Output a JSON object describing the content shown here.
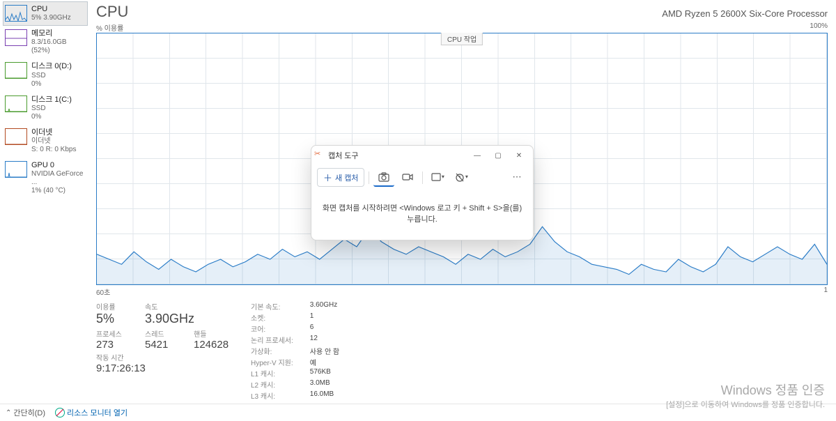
{
  "sidebar": [
    {
      "title": "CPU",
      "sub1": "5% 3.90GHz",
      "color": "#2a7cc7"
    },
    {
      "title": "메모리",
      "sub1": "8.3/16.0GB (52%)",
      "color": "#7a3fb1"
    },
    {
      "title": "디스크 0(D:)",
      "sub1": "SSD",
      "sub2": "0%",
      "color": "#4a9b2e"
    },
    {
      "title": "디스크 1(C:)",
      "sub1": "SSD",
      "sub2": "0%",
      "color": "#4a9b2e"
    },
    {
      "title": "이더넷",
      "sub1": "이더넷",
      "sub2": "S: 0 R: 0 Kbps",
      "color": "#b24a20"
    },
    {
      "title": "GPU 0",
      "sub1": "NVIDIA GeForce ...",
      "sub2": "1% (40 °C)",
      "color": "#2a7cc7"
    }
  ],
  "header": {
    "title": "CPU",
    "sub": "AMD Ryzen 5 2600X Six-Core Processor"
  },
  "axis": {
    "ylabel": "% 이용률",
    "ymax": "100%",
    "xmin": "60초",
    "xmax": "1"
  },
  "chart_tab": "CPU 작업",
  "stats": {
    "util_label": "이용률",
    "util": "5%",
    "speed_label": "속도",
    "speed": "3.90GHz",
    "proc_label": "프로세스",
    "proc": "273",
    "thread_label": "스레드",
    "thread": "5421",
    "handle_label": "핸들",
    "handle": "124628",
    "uptime_label": "작동 시간",
    "uptime": "9:17:26:13"
  },
  "right": [
    [
      "기본 속도:",
      "3.60GHz"
    ],
    [
      "소켓:",
      "1"
    ],
    [
      "코어:",
      "6"
    ],
    [
      "논리 프로세서:",
      "12"
    ],
    [
      "가상화:",
      "사용 안 함"
    ],
    [
      "Hyper-V 지원:",
      "예"
    ],
    [
      "L1 캐시:",
      "576KB"
    ],
    [
      "L2 캐시:",
      "3.0MB"
    ],
    [
      "L3 캐시:",
      "16.0MB"
    ]
  ],
  "footer": {
    "less": "간단히(D)",
    "resmon": "리소스 모니터 열기"
  },
  "watermark": {
    "t1": "Windows 정품 인증",
    "t2": "[설정]으로 이동하여 Windows를 정품 인증합니다."
  },
  "dialog": {
    "title": "캡처 도구",
    "new": "새 캡처",
    "body": "화면 캡처를 시작하려면 <Windows 로고 키 + Shift + S>을(를) 누릅니다."
  },
  "chart_data": {
    "type": "line",
    "title": "CPU % 이용률",
    "xlabel": "초",
    "ylabel": "% 이용률",
    "xlim": [
      60,
      1
    ],
    "ylim": [
      0,
      100
    ],
    "values": [
      12,
      10,
      8,
      13,
      9,
      6,
      10,
      7,
      5,
      8,
      10,
      7,
      9,
      12,
      10,
      14,
      11,
      13,
      10,
      14,
      18,
      15,
      22,
      17,
      14,
      12,
      15,
      13,
      11,
      8,
      12,
      10,
      14,
      11,
      13,
      16,
      23,
      17,
      13,
      11,
      8,
      7,
      6,
      4,
      8,
      6,
      5,
      10,
      7,
      5,
      8,
      15,
      11,
      9,
      12,
      15,
      12,
      10,
      16,
      8
    ]
  }
}
